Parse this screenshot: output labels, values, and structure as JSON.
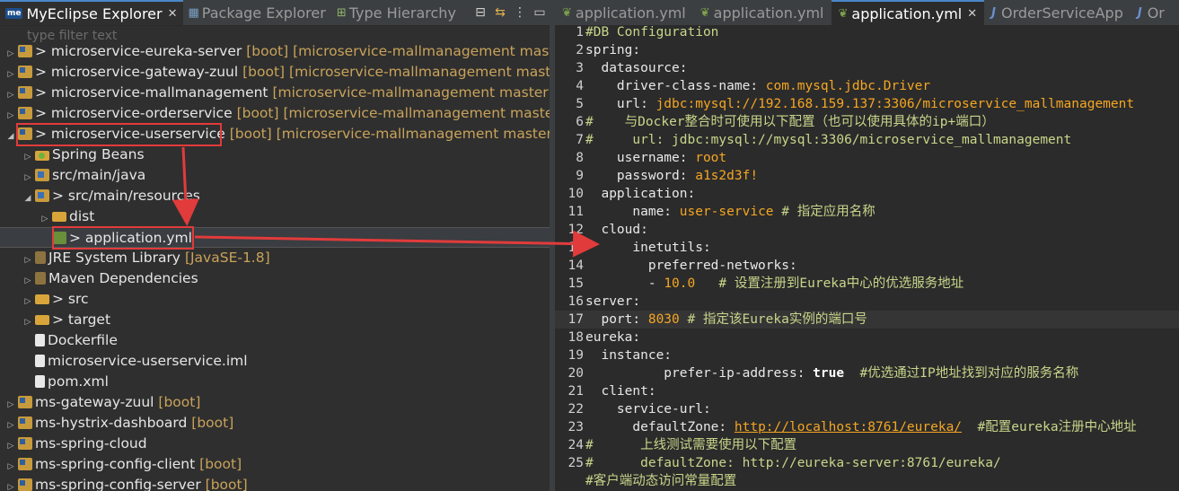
{
  "left_panel": {
    "tabs": [
      {
        "label": "MyEclipse Explorer",
        "badge": "me",
        "active": true
      },
      {
        "label": "Package Explorer"
      },
      {
        "label": "Type Hierarchy"
      }
    ],
    "filter_placeholder": "type filter text",
    "tree": [
      {
        "arrow": "▷",
        "icon": "project",
        "name": "> microservice-eureka-server",
        "deco": "[boot] [microservice-mallmanagement master]",
        "indent": 0
      },
      {
        "arrow": "▷",
        "icon": "project",
        "name": "> microservice-gateway-zuul",
        "deco": "[boot] [microservice-mallmanagement master]",
        "indent": 0
      },
      {
        "arrow": "▷",
        "icon": "project",
        "name": "> microservice-mallmanagement",
        "deco": "[microservice-mallmanagement master]",
        "indent": 0
      },
      {
        "arrow": "▷",
        "icon": "project",
        "name": "> microservice-orderservice",
        "deco": "[boot] [microservice-mallmanagement master]",
        "indent": 0
      },
      {
        "arrow": "◢",
        "icon": "project",
        "name": "> microservice-userservice",
        "deco": "[boot] [microservice-mallmanagement master]",
        "indent": 0
      },
      {
        "arrow": "▷",
        "icon": "beans",
        "name": "Spring Beans",
        "deco": "",
        "indent": 1
      },
      {
        "arrow": "▷",
        "icon": "src",
        "name": "src/main/java",
        "deco": "",
        "indent": 1
      },
      {
        "arrow": "◢",
        "icon": "src",
        "name": "> src/main/resources",
        "deco": "",
        "indent": 1
      },
      {
        "arrow": "▷",
        "icon": "folder",
        "name": "dist",
        "deco": "",
        "indent": 2
      },
      {
        "arrow": "",
        "icon": "yml",
        "name": "> application.yml",
        "deco": "",
        "indent": 2,
        "selected": true
      },
      {
        "arrow": "▷",
        "icon": "jar",
        "name": "JRE System Library",
        "deco": "[JavaSE-1.8]",
        "indent": 1
      },
      {
        "arrow": "▷",
        "icon": "jar",
        "name": "Maven Dependencies",
        "deco": "",
        "indent": 1
      },
      {
        "arrow": "▷",
        "icon": "folder",
        "name": "> src",
        "deco": "",
        "indent": 1
      },
      {
        "arrow": "▷",
        "icon": "folder",
        "name": "> target",
        "deco": "",
        "indent": 1
      },
      {
        "arrow": "",
        "icon": "file",
        "name": "Dockerfile",
        "deco": "",
        "indent": 1
      },
      {
        "arrow": "",
        "icon": "file",
        "name": "microservice-userservice.iml",
        "deco": "",
        "indent": 1
      },
      {
        "arrow": "",
        "icon": "file",
        "name": "pom.xml",
        "deco": "",
        "indent": 1
      },
      {
        "arrow": "▷",
        "icon": "project",
        "name": "ms-gateway-zuul",
        "deco": "[boot]",
        "indent": 0
      },
      {
        "arrow": "▷",
        "icon": "project",
        "name": "ms-hystrix-dashboard",
        "deco": "[boot]",
        "indent": 0
      },
      {
        "arrow": "▷",
        "icon": "project",
        "name": "ms-spring-cloud",
        "deco": "",
        "indent": 0
      },
      {
        "arrow": "▷",
        "icon": "project",
        "name": "ms-spring-config-client",
        "deco": "[boot]",
        "indent": 0
      },
      {
        "arrow": "▷",
        "icon": "project",
        "name": "ms-spring-config-server",
        "deco": "[boot]",
        "indent": 0
      }
    ]
  },
  "editor": {
    "tabs": [
      {
        "label": "application.yml",
        "icon": "yml-icon"
      },
      {
        "label": "application.yml",
        "icon": "yml-icon"
      },
      {
        "label": "application.yml",
        "icon": "yml-icon",
        "active": true
      },
      {
        "label": "OrderServiceApp",
        "icon": "java-icon"
      },
      {
        "label": "Or",
        "icon": "java-icon"
      }
    ],
    "lines": [
      {
        "n": "1",
        "segs": [
          [
            "c",
            "#DB Configuration"
          ]
        ]
      },
      {
        "n": "2",
        "segs": [
          [
            "k",
            "spring:"
          ]
        ]
      },
      {
        "n": "3",
        "segs": [
          [
            "k",
            "  datasource:"
          ]
        ]
      },
      {
        "n": "4",
        "segs": [
          [
            "k",
            "    driver-class-name: "
          ],
          [
            "v",
            "com.mysql.jdbc.Driver"
          ]
        ]
      },
      {
        "n": "5",
        "segs": [
          [
            "k",
            "    url: "
          ],
          [
            "v",
            "jdbc:mysql://192.168.159.137:3306/microservice_mallmanagement"
          ]
        ]
      },
      {
        "n": "6",
        "segs": [
          [
            "c",
            "#    与Docker整合时可使用以下配置（也可以使用具体的ip+端口）"
          ]
        ]
      },
      {
        "n": "7",
        "segs": [
          [
            "c",
            "#     url: jdbc:mysql://mysql:3306/microservice_mallmanagement"
          ]
        ]
      },
      {
        "n": "8",
        "segs": [
          [
            "k",
            "    username: "
          ],
          [
            "v",
            "root"
          ]
        ]
      },
      {
        "n": "9",
        "segs": [
          [
            "k",
            "    password: "
          ],
          [
            "v",
            "a1s2d3f!"
          ]
        ]
      },
      {
        "n": "10",
        "segs": [
          [
            "k",
            "  application:"
          ]
        ]
      },
      {
        "n": "11",
        "segs": [
          [
            "k",
            "      name: "
          ],
          [
            "v",
            "user-service "
          ],
          [
            "c",
            "# 指定应用名称"
          ]
        ]
      },
      {
        "n": "12",
        "segs": [
          [
            "k",
            "  cloud:"
          ]
        ]
      },
      {
        "n": "13",
        "segs": [
          [
            "k",
            "      inetutils:"
          ]
        ]
      },
      {
        "n": "14",
        "segs": [
          [
            "k",
            "        preferred-networks:"
          ]
        ]
      },
      {
        "n": "15",
        "segs": [
          [
            "k",
            "        - "
          ],
          [
            "n",
            "10.0"
          ],
          [
            "c",
            "   # 设置注册到Eureka中心的优选服务地址"
          ]
        ]
      },
      {
        "n": "16",
        "segs": [
          [
            "k",
            "server:"
          ]
        ]
      },
      {
        "n": "17",
        "segs": [
          [
            "k",
            "  port: "
          ],
          [
            "n",
            "8030 "
          ],
          [
            "c",
            "# 指定该Eureka实例的端口号"
          ]
        ],
        "highlight": true
      },
      {
        "n": "18",
        "segs": [
          [
            "k",
            "eureka:"
          ]
        ]
      },
      {
        "n": "19",
        "segs": [
          [
            "k",
            "  instance:"
          ]
        ]
      },
      {
        "n": "20",
        "segs": [
          [
            "k",
            "          prefer-ip-address: "
          ],
          [
            "b",
            "true"
          ],
          [
            "c",
            "  #优选通过IP地址找到对应的服务名称"
          ]
        ]
      },
      {
        "n": "21",
        "segs": [
          [
            "k",
            "  client:"
          ]
        ]
      },
      {
        "n": "22",
        "segs": [
          [
            "k",
            "    service-url:"
          ]
        ]
      },
      {
        "n": "23",
        "segs": [
          [
            "k",
            "      defaultZone: "
          ],
          [
            "u",
            "http://localhost:8761/eureka/"
          ],
          [
            "c",
            "  #配置eureka注册中心地址"
          ]
        ]
      },
      {
        "n": "24",
        "segs": [
          [
            "c",
            "#      上线测试需要使用以下配置"
          ]
        ]
      },
      {
        "n": "25",
        "segs": [
          [
            "c",
            "#      defaultZone: http://eureka-server:8761/eureka/"
          ]
        ]
      },
      {
        "n": "",
        "segs": [
          [
            "c",
            "#客户端动态访问常量配置"
          ]
        ]
      }
    ]
  },
  "colors": {
    "annotation": "#e23b3b",
    "accent": "#4a88c7"
  }
}
